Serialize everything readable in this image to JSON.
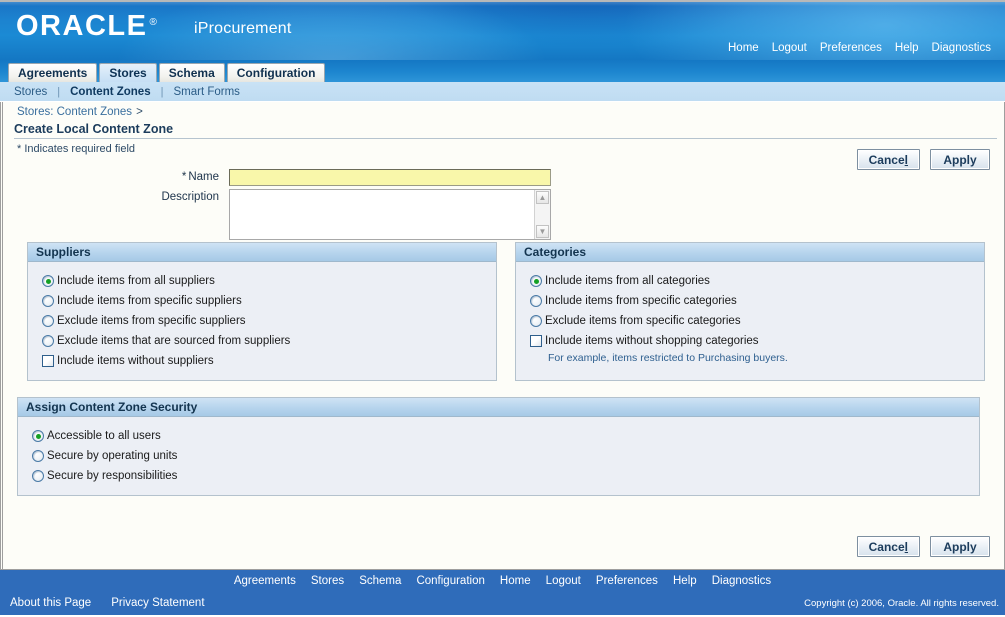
{
  "branding": {
    "logo_text": "ORACLE",
    "logo_reg": "®",
    "app_name": "iProcurement"
  },
  "global_links": [
    {
      "label": "Home"
    },
    {
      "label": "Logout"
    },
    {
      "label": "Preferences"
    },
    {
      "label": "Help"
    },
    {
      "label": "Diagnostics"
    }
  ],
  "tabs": [
    {
      "label": "Agreements",
      "active": false
    },
    {
      "label": "Stores",
      "active": true
    },
    {
      "label": "Schema",
      "active": false
    },
    {
      "label": "Configuration",
      "active": false
    }
  ],
  "subnav": {
    "items": [
      {
        "label": "Stores",
        "current": false
      },
      {
        "label": "Content Zones",
        "current": true
      },
      {
        "label": "Smart Forms",
        "current": false
      }
    ],
    "separator": "|"
  },
  "breadcrumb": {
    "link": "Stores: Content Zones",
    "separator": ">"
  },
  "page": {
    "title": "Create Local Content Zone",
    "required_hint": "* Indicates required field"
  },
  "buttons": {
    "cancel": "Cancel",
    "cancel_accesskey": "l",
    "apply": "Apply"
  },
  "form": {
    "name": {
      "label": "Name",
      "required_marker": "*",
      "value": "",
      "placeholder": ""
    },
    "description": {
      "label": "Description",
      "value": "",
      "placeholder": ""
    },
    "scroll_up_icon": "▲",
    "scroll_down_icon": "▼"
  },
  "suppliers_panel": {
    "title": "Suppliers",
    "options": [
      {
        "type": "radio",
        "label": "Include items from all suppliers",
        "checked": true
      },
      {
        "type": "radio",
        "label": "Include items from specific suppliers",
        "checked": false
      },
      {
        "type": "radio",
        "label": "Exclude items from specific suppliers",
        "checked": false
      },
      {
        "type": "radio",
        "label": "Exclude items that are sourced from suppliers",
        "checked": false
      },
      {
        "type": "checkbox",
        "label": "Include items without suppliers",
        "checked": false
      }
    ]
  },
  "categories_panel": {
    "title": "Categories",
    "options": [
      {
        "type": "radio",
        "label": "Include items from all categories",
        "checked": true
      },
      {
        "type": "radio",
        "label": "Include items from specific categories",
        "checked": false
      },
      {
        "type": "radio",
        "label": "Exclude items from specific categories",
        "checked": false
      },
      {
        "type": "checkbox",
        "label": "Include items without shopping categories",
        "checked": false
      }
    ],
    "hint": "For example, items restricted to Purchasing buyers."
  },
  "security_panel": {
    "title": "Assign Content Zone Security",
    "options": [
      {
        "type": "radio",
        "label": "Accessible to all users",
        "checked": true
      },
      {
        "type": "radio",
        "label": "Secure by operating units",
        "checked": false
      },
      {
        "type": "radio",
        "label": "Secure by responsibilities",
        "checked": false
      }
    ]
  },
  "footer": {
    "links": [
      {
        "label": "Agreements"
      },
      {
        "label": "Stores"
      },
      {
        "label": "Schema"
      },
      {
        "label": "Configuration"
      },
      {
        "label": "Home"
      },
      {
        "label": "Logout"
      },
      {
        "label": "Preferences"
      },
      {
        "label": "Help"
      },
      {
        "label": "Diagnostics"
      }
    ],
    "about_link": "About this Page",
    "privacy_link": "Privacy Statement",
    "copyright": "Copyright (c) 2006, Oracle. All rights reserved."
  },
  "colors": {
    "banner_blue": "#1b82cf",
    "footer_blue": "#2f6cba",
    "panel_header": "#b9d6ee",
    "panel_body": "#eceff5",
    "required_field": "#f9f7aa",
    "radio_dot_green": "#14a024",
    "link_blue": "#3a6f9e"
  }
}
